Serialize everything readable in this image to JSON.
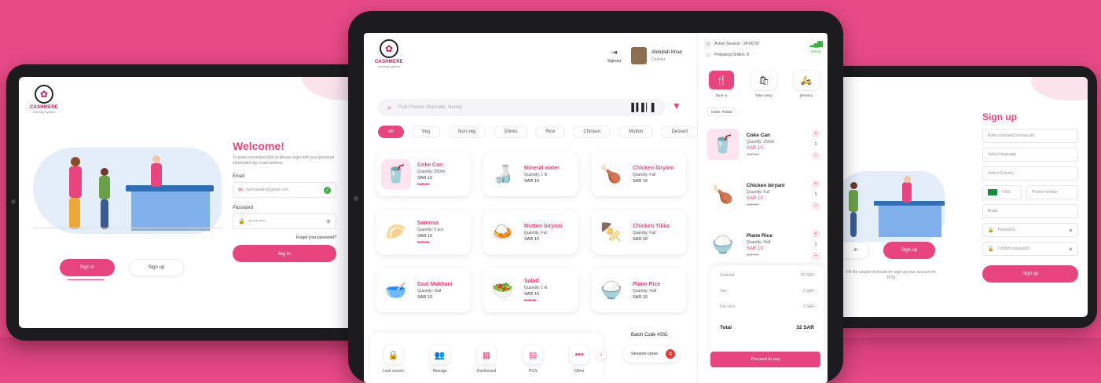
{
  "brand": {
    "name": "CASHMERE",
    "tagline": "ordering system"
  },
  "colors": {
    "accent": "#e8457f",
    "background": "#e84a86",
    "online": "#3cb043"
  },
  "login": {
    "welcome": "Welcome!",
    "subtitle": "To keep connected with us please login with your personal information by email address",
    "email_label": "Email",
    "email_value": "fatimakashi@gmail.com",
    "password_label": "Password",
    "password_value": "••••••••••••",
    "forgot": "Forgot your password?",
    "login_button": "log in",
    "signin_tab": "Sign in",
    "signup_tab": "Sign up"
  },
  "pos": {
    "user": {
      "name": "Abdullah Khan",
      "role": "Cashier"
    },
    "signout": "Signout",
    "search_placeholder": "Find Product (Barcode, Name)",
    "categories": [
      "All",
      "Veg",
      "Non veg",
      "Drinks",
      "Rice",
      "Chicken",
      "Mutton",
      "Dessert"
    ],
    "products": [
      {
        "name": "Coke Can",
        "qty": "Quantity: 250ml",
        "price": "SAR 10",
        "old": "SAR 15",
        "icon": "soda-can-icon",
        "glyph": "🥤"
      },
      {
        "name": "Mineral water",
        "qty": "Quantity: 1 ltr",
        "price": "SAR 10",
        "old": "",
        "icon": "water-bottle-icon",
        "glyph": "🍶"
      },
      {
        "name": "Chicken biryani",
        "qty": "Quantity: Full",
        "price": "SAR 10",
        "old": "",
        "icon": "biryani-icon",
        "glyph": "🍗"
      },
      {
        "name": "Samosa",
        "qty": "Quantity: 3 pcs",
        "price": "SAR 10",
        "old": "SAR 15",
        "icon": "samosa-icon",
        "glyph": "🥟"
      },
      {
        "name": "Mutton biryani",
        "qty": "Quantity: Full",
        "price": "SAR 10",
        "old": "",
        "icon": "rice-bowl-icon",
        "glyph": "🍛"
      },
      {
        "name": "Chicken Tikka",
        "qty": "Quantity: Full",
        "price": "SAR 10",
        "old": "",
        "icon": "tikka-icon",
        "glyph": "🍢"
      },
      {
        "name": "Daal Makhani",
        "qty": "Quantity: Half",
        "price": "SAR 10",
        "old": "",
        "icon": "daal-bowl-icon",
        "glyph": "🥣"
      },
      {
        "name": "Salad",
        "qty": "Quantity: 1 kt",
        "price": "SAR 10",
        "old": "SAR 15",
        "icon": "salad-bottle-icon",
        "glyph": "🥗"
      },
      {
        "name": "Plane Rice",
        "qty": "Quantity: Half",
        "price": "SAR 10",
        "old": "",
        "icon": "rice-plate-icon",
        "glyph": "🍚"
      }
    ],
    "bottom_nav": [
      {
        "label": "Lock screen",
        "icon": "lock-icon",
        "glyph": "🔒"
      },
      {
        "label": "Manage",
        "icon": "users-icon",
        "glyph": "👥"
      },
      {
        "label": "Dashboard",
        "icon": "dashboard-icon",
        "glyph": "▦"
      },
      {
        "label": "POS",
        "icon": "receipt-icon",
        "glyph": "▤"
      },
      {
        "label": "Other",
        "icon": "more-icon",
        "glyph": "•••"
      }
    ],
    "batch_code": "Batch Code #002",
    "session_close": "Session close"
  },
  "order": {
    "active_session": "Active Session : 24:00:00",
    "preparing": "Preparing Orders: 9",
    "online": "Online",
    "services": [
      {
        "label": "Dine in",
        "icon": "dine-in-icon",
        "glyph": "🍴",
        "active": true
      },
      {
        "label": "Take Away",
        "icon": "takeaway-icon",
        "glyph": "🛍"
      },
      {
        "label": "Delivery",
        "icon": "delivery-icon",
        "glyph": "🛵"
      }
    ],
    "order_no": "Order: #1015",
    "items": [
      {
        "name": "Coke Can",
        "qty": "Quantity: 250ml",
        "price": "SAR 10",
        "old": "SAR 15",
        "count": "1",
        "glyph": "🥤"
      },
      {
        "name": "Chicken biryani",
        "qty": "Quantity: Full",
        "price": "SAR 10",
        "old": "SAR 15",
        "count": "1",
        "glyph": "🍗"
      },
      {
        "name": "Plane Rice",
        "qty": "Quantity: Half",
        "price": "SAR 10",
        "old": "SAR 15",
        "count": "1",
        "glyph": "🍚"
      }
    ],
    "summary": [
      {
        "label": "Subtotal",
        "value": "30 SAR"
      },
      {
        "label": "Tax",
        "value": "2 SAR"
      },
      {
        "label": "Discount",
        "value": "0 SAR"
      }
    ],
    "total_label": "Total",
    "total_value": "32 SAR",
    "proceed": "Proceed to pay"
  },
  "signup": {
    "title": "Sign up",
    "fields": [
      "Enter company/ restaurant",
      "Select language",
      "Select Country"
    ],
    "phone_code": "+966",
    "phone_placeholder": "Phone number",
    "email_placeholder": "Email",
    "password_placeholder": "Password",
    "confirm_placeholder": "Confirm password",
    "button": "Sign up",
    "signin_tab": "in",
    "signup_tab": "Sign up",
    "note": "Fill the couple of details for sign up your account for POS"
  }
}
